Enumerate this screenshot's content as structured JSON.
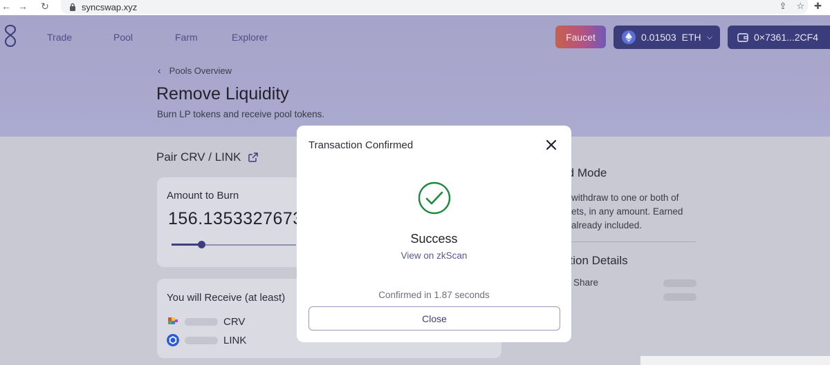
{
  "browser": {
    "url": "syncswap.xyz"
  },
  "nav": {
    "items": [
      {
        "label": "Trade"
      },
      {
        "label": "Pool"
      },
      {
        "label": "Farm"
      },
      {
        "label": "Explorer"
      }
    ]
  },
  "header": {
    "faucet_label": "Faucet",
    "eth_balance": "0.01503",
    "eth_symbol": "ETH",
    "wallet_address": "0×7361...2CF4"
  },
  "page": {
    "back_label": "Pools Overview",
    "title": "Remove Liquidity",
    "subtitle": "Burn LP tokens and receive pool tokens."
  },
  "pair": {
    "label": "Pair CRV / LINK"
  },
  "burn": {
    "label": "Amount to Burn",
    "value": "156.1353327673"
  },
  "receive": {
    "label": "You will Receive (at least)",
    "tokens": [
      {
        "symbol": "CRV"
      },
      {
        "symbol": "LINK"
      }
    ]
  },
  "side": {
    "mode_heading": "rd Mode",
    "mode_text_1": "withdraw to one or both of",
    "mode_text_2": "ets, in any amount. Earned",
    "mode_text_3": "already included.",
    "details_heading": "ction Details",
    "share_label": "Share"
  },
  "modal": {
    "title": "Transaction Confirmed",
    "status": "Success",
    "explorer_link": "View on zkScan",
    "confirmed_text": "Confirmed in 1.87 seconds",
    "close_label": "Close"
  },
  "colors": {
    "accent": "#3a3c7c",
    "success": "#1a8a3c",
    "link": "#55579a"
  }
}
